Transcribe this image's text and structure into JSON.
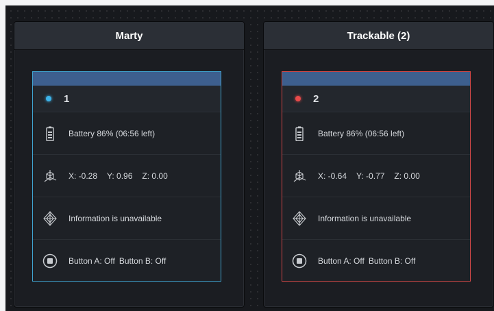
{
  "panels": [
    {
      "title": "Marty",
      "device_number": "1",
      "status_color": "#3db4ea",
      "battery": "Battery 86% (06:56 left)",
      "position": {
        "x": "X: -0.28",
        "y": "Y: 0.96",
        "z": "Z: 0.00"
      },
      "orientation": "Information is unavailable",
      "buttons": {
        "a": "Button A: Off",
        "b": "Button B: Off"
      }
    },
    {
      "title": "Trackable (2)",
      "device_number": "2",
      "status_color": "#e84a4a",
      "battery": "Battery 86% (06:56 left)",
      "position": {
        "x": "X: -0.64",
        "y": "Y: -0.77",
        "z": "Z: 0.00"
      },
      "orientation": "Information is unavailable",
      "buttons": {
        "a": "Button A: Off",
        "b": "Button B: Off"
      }
    }
  ],
  "icons": {
    "status": "status-dot",
    "battery": "battery-icon",
    "position": "axes-icon",
    "orientation": "orientation-icon",
    "button": "button-icon"
  }
}
